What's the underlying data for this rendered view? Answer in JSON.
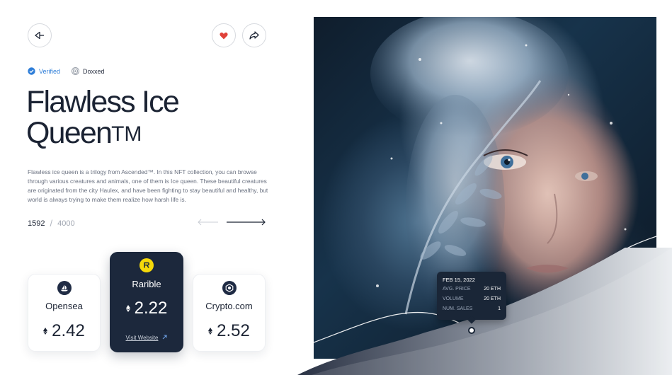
{
  "header": {
    "back_icon": "arrow-left-icon",
    "like_icon": "heart-icon",
    "share_icon": "share-icon"
  },
  "badges": [
    {
      "label": "Verified",
      "icon": "verified-check-icon",
      "color": "#2f7ed8"
    },
    {
      "label": "Doxxed",
      "icon": "fingerprint-icon"
    }
  ],
  "collection": {
    "title_line1": "Flawless Ice",
    "title_line2": "Queen",
    "title_mark": "TM",
    "description": "Flawless ice queen is a trilogy from Ascended™. In this NFT collection, you can browse through various creatures and animals, one of them is Ice queen. These beautiful creatures are originated from the city Haulex, and have been fighting to stay beautiful and healthy, but world is always trying to make them realize how harsh life is.",
    "current": "1592",
    "separator": "/",
    "total": "4000"
  },
  "marketplaces": [
    {
      "name": "Opensea",
      "price": "2.42",
      "icon": "opensea-icon"
    },
    {
      "name": "Rarible",
      "price": "2.22",
      "icon": "rarible-icon",
      "link_label": "Visit Website",
      "accent": "#f5d90a"
    },
    {
      "name": "Crypto.com",
      "price": "2.52",
      "icon": "cryptocom-icon"
    }
  ],
  "stats_tooltip": {
    "date": "FEB 15, 2022",
    "rows": [
      {
        "label": "AVG. PRICE",
        "value": "20 ETH"
      },
      {
        "label": "VOLUME",
        "value": "20 ETH"
      },
      {
        "label": "NUM. SALES",
        "value": "1"
      }
    ]
  },
  "colors": {
    "dark_navy": "#1c283c",
    "like_red": "#e0423a",
    "verified_blue": "#2f7ed8"
  }
}
